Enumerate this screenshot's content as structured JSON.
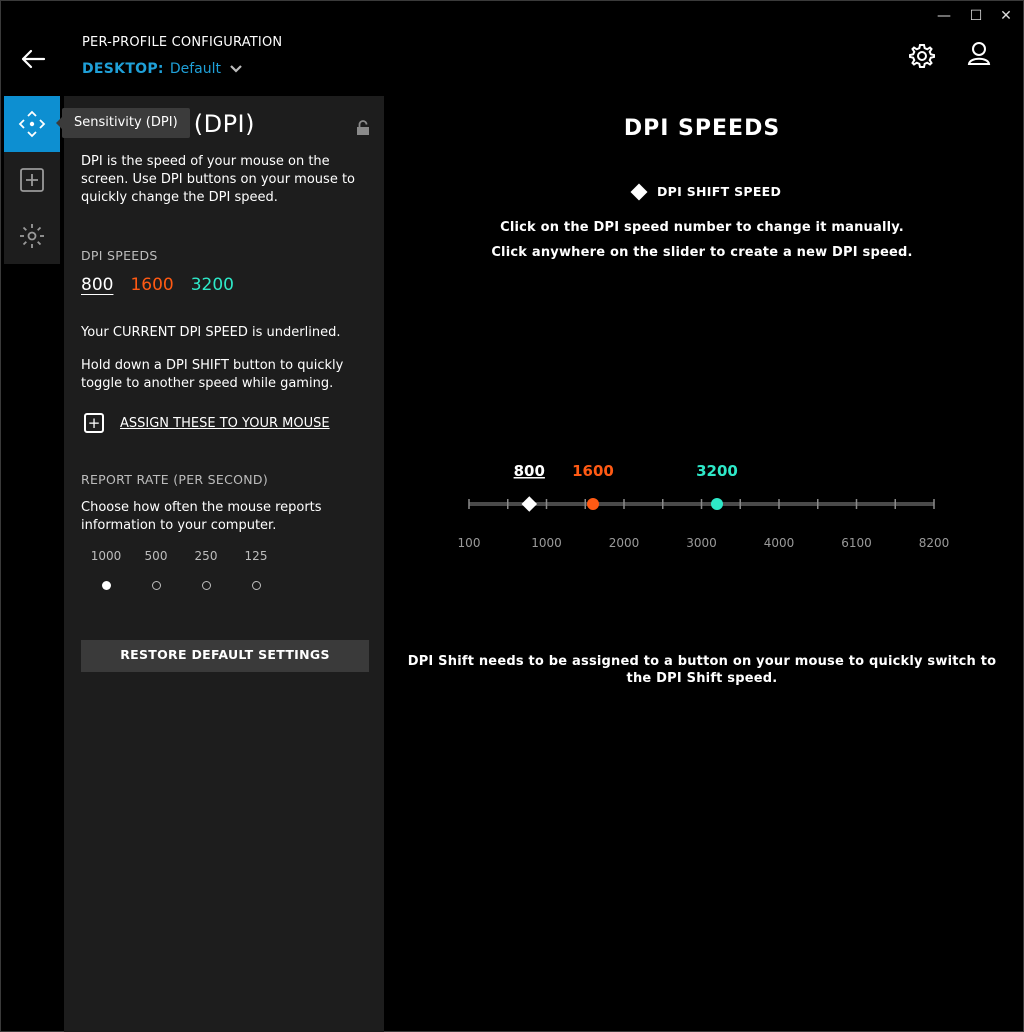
{
  "window": {
    "minimize_glyph": "—",
    "maximize_glyph": "☐",
    "close_glyph": "✕"
  },
  "header": {
    "title": "PER-PROFILE CONFIGURATION",
    "profile_label": "DESKTOP:",
    "profile_value": "Default",
    "accent_color": "#1fa0d8"
  },
  "rail": {
    "items": [
      {
        "name": "sensitivity",
        "icon": "move-icon",
        "active": true
      },
      {
        "name": "assignments",
        "icon": "plus-square-icon",
        "active": false
      },
      {
        "name": "lighting",
        "icon": "sun-icon",
        "active": false
      }
    ],
    "tooltip": "Sensitivity (DPI)"
  },
  "panel": {
    "title": "Sensitivity (DPI)",
    "title_visible": "ty (DPI)",
    "description": "DPI is the speed of your mouse on the screen. Use DPI buttons on your mouse to quickly change the DPI speed.",
    "dpi_speeds_label": "DPI SPEEDS",
    "dpi_values": [
      {
        "value": "800",
        "color": "#ffffff",
        "current": true
      },
      {
        "value": "1600",
        "color": "#ff5a14",
        "current": false
      },
      {
        "value": "3200",
        "color": "#2ee8c8",
        "current": false
      }
    ],
    "current_note": "Your CURRENT DPI SPEED is underlined.",
    "shift_note": "Hold down a DPI SHIFT button to quickly toggle to another speed while gaming.",
    "assign_label": "ASSIGN THESE TO YOUR MOUSE",
    "report_rate_label": "REPORT RATE (PER SECOND)",
    "report_rate_desc": "Choose how often the mouse reports information to your computer.",
    "report_rates": [
      {
        "value": "1000",
        "selected": true
      },
      {
        "value": "500",
        "selected": false
      },
      {
        "value": "250",
        "selected": false
      },
      {
        "value": "125",
        "selected": false
      }
    ],
    "restore_label": "RESTORE DEFAULT SETTINGS"
  },
  "main": {
    "title": "DPI SPEEDS",
    "shift_label": "DPI SHIFT SPEED",
    "instruction_1": "Click on the DPI speed number to change it manually.",
    "instruction_2": "Click anywhere on the slider to create a new DPI speed.",
    "bottom_note": "DPI Shift needs to be assigned to a button on your mouse to quickly switch to the DPI Shift speed."
  },
  "slider": {
    "tick_labels": [
      "100",
      "1000",
      "2000",
      "3000",
      "4000",
      "6100",
      "8200"
    ],
    "tick_count": 13,
    "stops": [
      {
        "value": "800",
        "color": "#ffffff",
        "shape": "diamond",
        "underlined": true
      },
      {
        "value": "1600",
        "color": "#ff5a14",
        "shape": "circle",
        "underlined": false
      },
      {
        "value": "3200",
        "color": "#2ee8c8",
        "shape": "circle",
        "underlined": false
      }
    ]
  }
}
